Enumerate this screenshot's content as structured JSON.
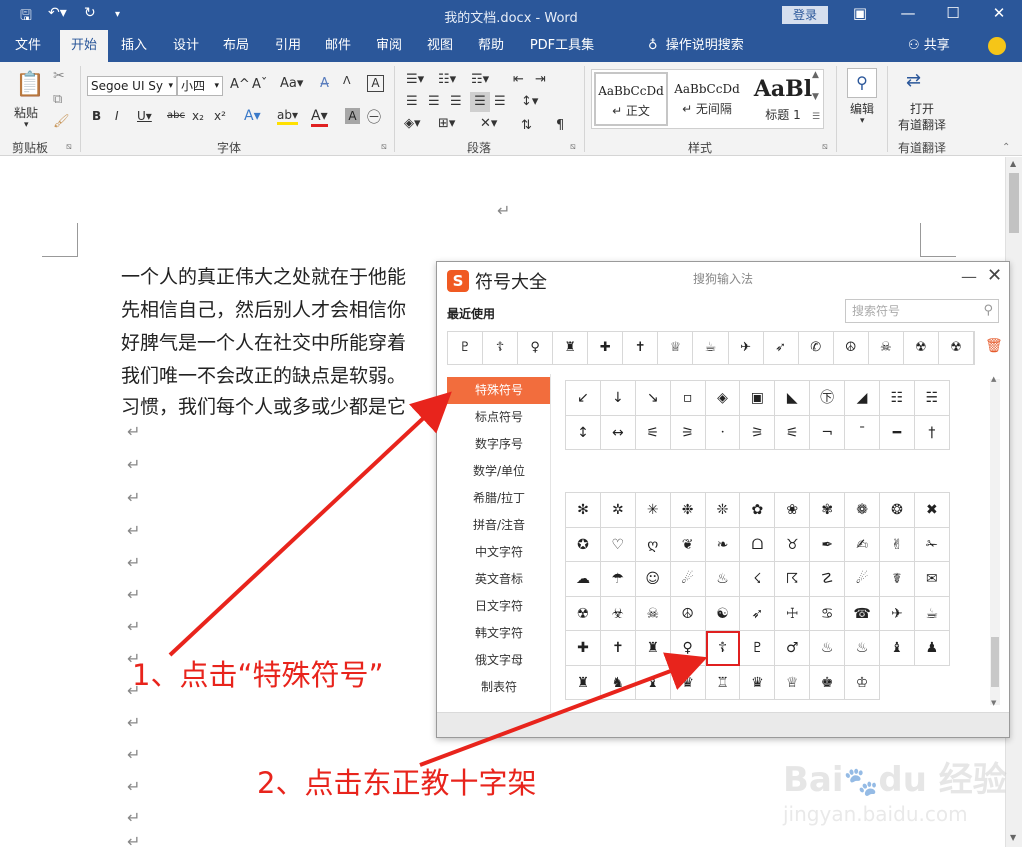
{
  "window": {
    "title": "我的文档.docx  -  Word",
    "login_label": "登录",
    "quick_access": {
      "save_icon": "save-icon",
      "undo_icon": "undo-icon",
      "redo_icon": "redo-icon",
      "customize_icon": "customize-qat-icon"
    }
  },
  "tabs": [
    "文件",
    "开始",
    "插入",
    "设计",
    "布局",
    "引用",
    "邮件",
    "审阅",
    "视图",
    "帮助",
    "PDF工具集"
  ],
  "active_tab": "开始",
  "tellme_label": "操作说明搜索",
  "share_label": "共享",
  "ribbon": {
    "clipboard": {
      "paste_label": "粘贴",
      "group_label": "剪贴板"
    },
    "font": {
      "font_name": "Segoe UI Sy",
      "font_size": "小四",
      "group_label": "字体"
    },
    "paragraph": {
      "group_label": "段落"
    },
    "styles": {
      "group_label": "样式",
      "items": [
        {
          "preview": "AaBbCcDd",
          "label": "↵ 正文"
        },
        {
          "preview": "AaBbCcDd",
          "label": "↵ 无间隔"
        },
        {
          "preview": "AaBl",
          "label": "标题 1"
        }
      ]
    },
    "editing": {
      "label": "编辑"
    },
    "translate": {
      "label_line1": "打开",
      "label_line2": "有道翻译",
      "group_label": "有道翻译"
    }
  },
  "document": {
    "paragraphs": [
      "一个人的真正伟大之处就在于他能",
      "先相信自己，然后别人才会相信你",
      "好脾气是一个人在社交中所能穿着",
      "我们唯一不会改正的缺点是软弱。",
      "习惯，我们每个人或多或少都是它"
    ],
    "paragraph_mark": "↵"
  },
  "dialog": {
    "title": "符号大全",
    "subtitle": "搜狗输入法",
    "logo_text": "S",
    "recent_label": "最近使用",
    "search_placeholder": "搜索符号",
    "recent_symbols": [
      "♇",
      "☦",
      "♀",
      "♜",
      "✚",
      "✝",
      "♕",
      "☕",
      "✈",
      "➶",
      "✆",
      "☮",
      "☠",
      "☢",
      "☢",
      "☎",
      "✉"
    ],
    "categories": [
      "特殊符号",
      "标点符号",
      "数字序号",
      "数学/单位",
      "希腊/拉丁",
      "拼音/注音",
      "中文字符",
      "英文音标",
      "日文字符",
      "韩文字符",
      "俄文字母",
      "制表符"
    ],
    "active_category": "特殊符号",
    "grid_top_rows": [
      [
        "↙",
        "↓",
        "↘",
        "▫",
        "◈",
        "▣",
        "◣",
        "㊦",
        "◢",
        "☷",
        "☵",
        "☰"
      ],
      [
        "↕",
        "↔",
        "⚟",
        "⚞",
        "ㆍ",
        "⚞",
        "⚟",
        "¬",
        "¯",
        "━",
        "†",
        "‡"
      ]
    ],
    "grid_main_rows": [
      [
        "✻",
        "✲",
        "✳",
        "❉",
        "❊",
        "✿",
        "❀",
        "✾",
        "❁",
        "❂",
        "✖",
        "✚"
      ],
      [
        "✪",
        "♡",
        "ღ",
        "❦",
        "❧",
        "ᗝ",
        "♉",
        "✒",
        "✍",
        "✌",
        "✁",
        "✄"
      ],
      [
        "☁",
        "☂",
        "☺",
        "☄",
        "♨",
        "☇",
        "☈",
        "☡",
        "☄",
        "☤",
        "✉",
        "☏"
      ],
      [
        "☢",
        "☣",
        "☠",
        "☮",
        "☯",
        "➶",
        "☩",
        "♋",
        "☎",
        "✈",
        "☕",
        "♕"
      ],
      [
        "✚",
        "✝",
        "♜",
        "♀",
        "☦",
        "♇",
        "♂",
        "♨",
        "♨",
        "♝",
        "♟",
        "♜"
      ],
      [
        "♜",
        "♞",
        "♝",
        "♛",
        "♖",
        "♛",
        "♕",
        "♚",
        "♔"
      ]
    ],
    "highlighted_symbol": "☦"
  },
  "annotations": {
    "step1": "1、点击“特殊符号”",
    "step2": "2、点击东正教十字架"
  },
  "colors": {
    "accent": "#2b579a",
    "category_active": "#f26d3d",
    "annotation": "#e8241c"
  }
}
